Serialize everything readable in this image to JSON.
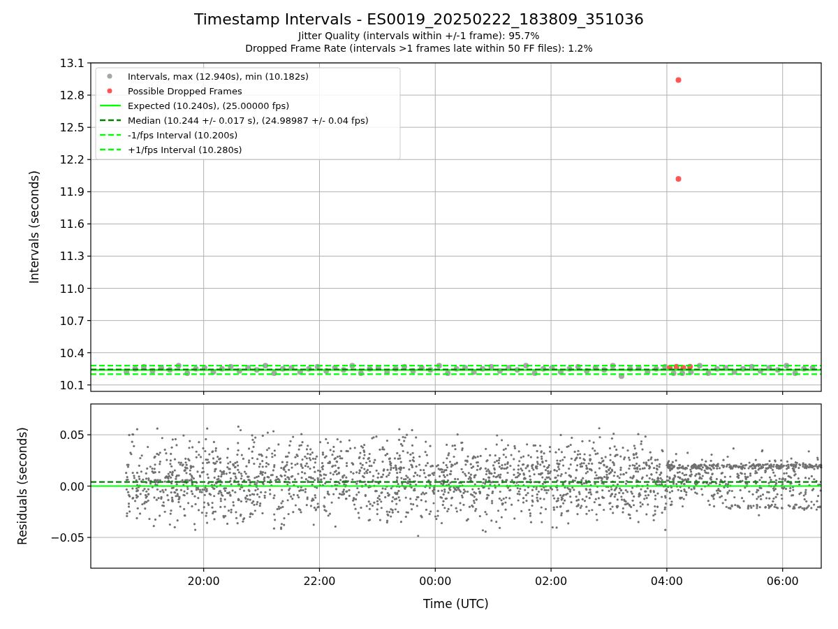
{
  "figure": {
    "title": "Timestamp Intervals - ES0019_20250222_183809_351036",
    "subtitles": [
      "Jitter Quality (intervals within +/-1 frame): 95.7%",
      "Dropped Frame Rate (intervals >1 frames late within 50 FF files): 1.2%"
    ]
  },
  "intervals_plot": {
    "chart_data": {
      "type": "scatter",
      "ylabel": "Intervals (seconds)",
      "grid": true,
      "legend": true,
      "x": [
        "2025-02-22T18:03",
        "2025-02-23T06:40"
      ],
      "xlim": [
        "2025-02-22T18:03",
        "2025-02-23T06:40"
      ],
      "ylim": [
        10.04,
        13.1
      ],
      "yticks": [
        {
          "value": 10.1,
          "label": "10.1"
        },
        {
          "value": 10.4,
          "label": "10.4"
        },
        {
          "value": 10.7,
          "label": "10.7"
        },
        {
          "value": 11.0,
          "label": "11.0"
        },
        {
          "value": 11.3,
          "label": "11.3"
        },
        {
          "value": 11.6,
          "label": "11.6"
        },
        {
          "value": 11.9,
          "label": "11.9"
        },
        {
          "value": 12.2,
          "label": "12.2"
        },
        {
          "value": 12.5,
          "label": "12.5"
        },
        {
          "value": 12.8,
          "label": "12.8"
        },
        {
          "value": 13.1,
          "label": "13.1"
        }
      ],
      "series": [
        {
          "name": "Intervals, max (12.940s), min (10.182s)",
          "color": "#a6a6a6",
          "type": "scatter",
          "x": [
            "2025-02-22T18:40",
            "2025-02-22T18:49",
            "2025-02-22T18:58",
            "2025-02-22T19:07",
            "2025-02-22T19:16",
            "2025-02-22T19:25",
            "2025-02-22T19:34",
            "2025-02-22T19:43",
            "2025-02-22T19:52",
            "2025-02-22T20:01",
            "2025-02-22T20:10",
            "2025-02-22T20:19",
            "2025-02-22T20:28",
            "2025-02-22T20:37",
            "2025-02-22T20:46",
            "2025-02-22T20:55",
            "2025-02-22T21:04",
            "2025-02-22T21:13",
            "2025-02-22T21:22",
            "2025-02-22T21:31",
            "2025-02-22T21:40",
            "2025-02-22T21:49",
            "2025-02-22T21:58",
            "2025-02-22T22:07",
            "2025-02-22T22:16",
            "2025-02-22T22:25",
            "2025-02-22T22:34",
            "2025-02-22T22:43",
            "2025-02-22T22:52",
            "2025-02-22T23:01",
            "2025-02-22T23:10",
            "2025-02-22T23:19",
            "2025-02-22T23:28",
            "2025-02-22T23:37",
            "2025-02-22T23:46",
            "2025-02-22T23:55",
            "2025-02-23T00:04",
            "2025-02-23T00:13",
            "2025-02-23T00:22",
            "2025-02-23T00:31",
            "2025-02-23T00:40",
            "2025-02-23T00:49",
            "2025-02-23T00:58",
            "2025-02-23T01:07",
            "2025-02-23T01:16",
            "2025-02-23T01:25",
            "2025-02-23T01:34",
            "2025-02-23T01:43",
            "2025-02-23T01:52",
            "2025-02-23T02:01",
            "2025-02-23T02:10",
            "2025-02-23T02:19",
            "2025-02-23T02:28",
            "2025-02-23T02:37",
            "2025-02-23T02:46",
            "2025-02-23T02:55",
            "2025-02-23T03:04",
            "2025-02-23T03:13",
            "2025-02-23T03:22",
            "2025-02-23T03:31",
            "2025-02-23T03:40",
            "2025-02-23T03:49",
            "2025-02-23T03:58",
            "2025-02-23T04:07",
            "2025-02-23T04:16",
            "2025-02-23T04:25",
            "2025-02-23T04:34",
            "2025-02-23T04:43",
            "2025-02-23T04:52",
            "2025-02-23T05:01",
            "2025-02-23T05:10",
            "2025-02-23T05:19",
            "2025-02-23T05:28",
            "2025-02-23T05:37",
            "2025-02-23T05:46",
            "2025-02-23T05:55",
            "2025-02-23T06:04",
            "2025-02-23T06:13",
            "2025-02-23T06:22",
            "2025-02-23T06:31"
          ],
          "values": [
            10.22,
            10.25,
            10.27,
            10.23,
            10.26,
            10.24,
            10.28,
            10.21,
            10.25,
            10.26,
            10.22,
            10.25,
            10.27,
            10.23,
            10.26,
            10.24,
            10.28,
            10.21,
            10.25,
            10.26,
            10.22,
            10.25,
            10.27,
            10.23,
            10.26,
            10.24,
            10.28,
            10.21,
            10.25,
            10.26,
            10.22,
            10.25,
            10.27,
            10.23,
            10.26,
            10.24,
            10.28,
            10.21,
            10.25,
            10.26,
            10.22,
            10.25,
            10.27,
            10.23,
            10.26,
            10.24,
            10.28,
            10.21,
            10.25,
            10.26,
            10.22,
            10.25,
            10.27,
            10.23,
            10.26,
            10.24,
            10.28,
            10.182,
            10.25,
            10.26,
            10.22,
            10.25,
            10.27,
            10.21,
            10.21,
            10.22,
            10.28,
            10.21,
            10.25,
            10.26,
            10.22,
            10.25,
            10.27,
            10.23,
            10.26,
            10.24,
            10.28,
            10.21,
            10.25,
            10.26
          ]
        },
        {
          "name": "Possible Dropped Frames",
          "color": "#ff5555",
          "type": "scatter",
          "x": [
            "2025-02-23T04:12",
            "2025-02-23T04:12",
            "2025-02-23T04:03",
            "2025-02-23T04:10",
            "2025-02-23T04:17",
            "2025-02-23T04:24"
          ],
          "values": [
            12.94,
            12.02,
            10.26,
            10.27,
            10.26,
            10.27
          ]
        },
        {
          "name": "Expected (10.240s), (25.00000 fps)",
          "color": "#00ff00",
          "type": "line",
          "line_style": "solid",
          "values": [
            10.24,
            10.24
          ]
        },
        {
          "name": "Median (10.244 +/- 0.017 s), (24.98987 +/- 0.04 fps)",
          "color": "#008000",
          "type": "line",
          "line_style": "dashed",
          "values": [
            10.244,
            10.244
          ]
        },
        {
          "name": "-1/fps Interval (10.200s)",
          "color": "#00ff00",
          "type": "line",
          "line_style": "dashed",
          "values": [
            10.2,
            10.2
          ]
        },
        {
          "name": "+1/fps Interval (10.280s)",
          "color": "#00ff00",
          "type": "line",
          "line_style": "dashed",
          "values": [
            10.28,
            10.28
          ]
        }
      ]
    }
  },
  "residuals_plot": {
    "chart_data": {
      "type": "scatter",
      "xlabel": "Time (UTC)",
      "ylabel": "Residuals (seconds)",
      "grid": true,
      "x": [
        "2025-02-22T18:03",
        "2025-02-23T06:40"
      ],
      "xlim": [
        "2025-02-22T18:03",
        "2025-02-23T06:40"
      ],
      "ylim": [
        -0.08,
        0.08
      ],
      "xticks": [
        {
          "value": "2025-02-22T20:00",
          "label": "20:00"
        },
        {
          "value": "2025-02-22T22:00",
          "label": "22:00"
        },
        {
          "value": "2025-02-23T00:00",
          "label": "00:00"
        },
        {
          "value": "2025-02-23T02:00",
          "label": "02:00"
        },
        {
          "value": "2025-02-23T04:00",
          "label": "04:00"
        },
        {
          "value": "2025-02-23T06:00",
          "label": "06:00"
        }
      ],
      "yticks": [
        {
          "value": 0.05,
          "label": "0.05"
        },
        {
          "value": 0,
          "label": "0.00"
        },
        {
          "value": -0.05,
          "label": "−0.05"
        }
      ],
      "series": [
        {
          "color": "#00ff00",
          "type": "line",
          "line_style": "solid",
          "values": [
            0,
            0
          ]
        },
        {
          "color": "#008000",
          "type": "line",
          "line_style": "dashed",
          "values": [
            0.004,
            0.004
          ]
        }
      ]
    }
  }
}
